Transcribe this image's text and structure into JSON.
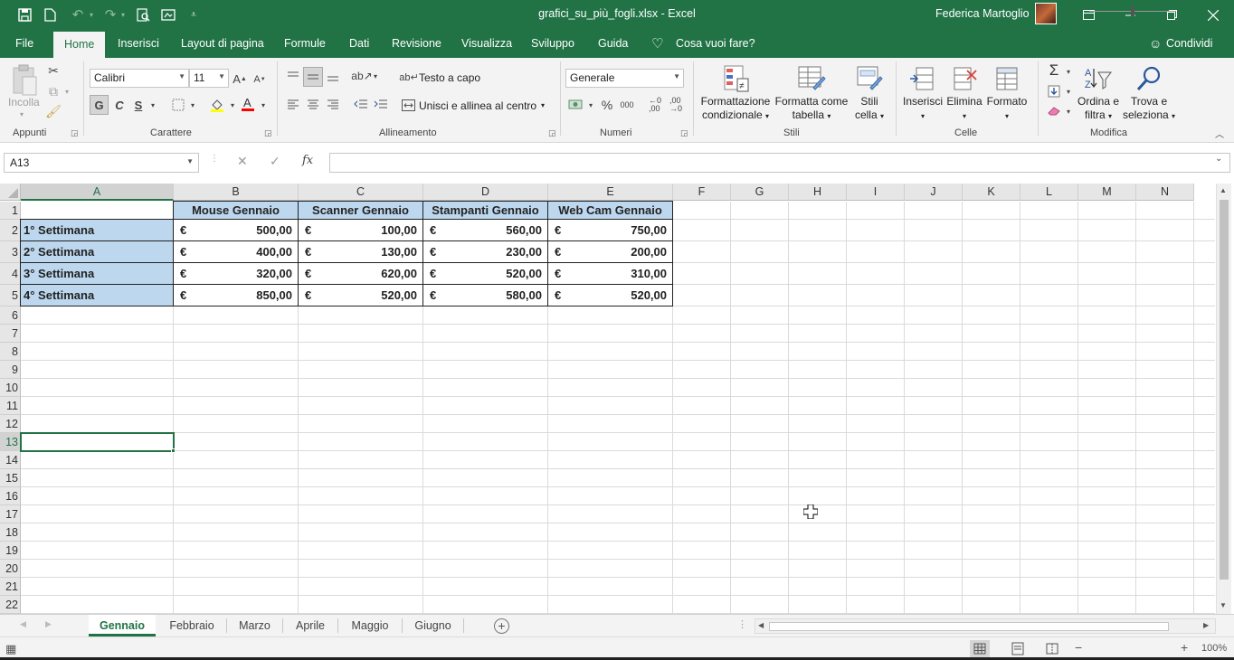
{
  "titlebar": {
    "filename": "grafici_su_più_fogli.xlsx  -  Excel",
    "user": "Federica Martoglio",
    "icons": [
      "save-icon",
      "new-file-icon",
      "undo-icon",
      "redo-icon",
      "print-preview-icon",
      "camera-icon",
      "customize-icon"
    ]
  },
  "menu": {
    "tabs": [
      "File",
      "Home",
      "Inserisci",
      "Layout di pagina",
      "Formule",
      "Dati",
      "Revisione",
      "Visualizza",
      "Sviluppo",
      "Guida"
    ],
    "active": "Home",
    "tell_me": "Cosa vuoi fare?",
    "share": "Condividi"
  },
  "ribbon": {
    "clipboard": {
      "paste": "Incolla",
      "label": "Appunti"
    },
    "font": {
      "name": "Calibri",
      "size": "11",
      "bold": "G",
      "italic": "C",
      "underline": "S",
      "label": "Carattere"
    },
    "alignment": {
      "wrap": "Testo a capo",
      "merge": "Unisci e allinea al centro",
      "label": "Allineamento"
    },
    "number": {
      "format": "Generale",
      "percent": "%",
      "thousands": "000",
      "label": "Numeri"
    },
    "styles": {
      "cond_format": "Formattazione",
      "cond_format2": "condizionale",
      "format_table": "Formatta come",
      "format_table2": "tabella",
      "cell_styles": "Stili",
      "cell_styles2": "cella",
      "label": "Stili"
    },
    "cells": {
      "insert": "Inserisci",
      "delete": "Elimina",
      "format": "Formato",
      "label": "Celle"
    },
    "editing": {
      "sort": "Ordina e",
      "sort2": "filtra",
      "find": "Trova e",
      "find2": "seleziona",
      "label": "Modifica"
    }
  },
  "formula_bar": {
    "name_box": "A13",
    "fx": "fx",
    "content": ""
  },
  "columns": [
    "A",
    "B",
    "C",
    "D",
    "E",
    "F",
    "G",
    "H",
    "I",
    "J",
    "K",
    "L",
    "M",
    "N"
  ],
  "rows": [
    "1",
    "2",
    "3",
    "4",
    "5",
    "6",
    "7",
    "8",
    "9",
    "10",
    "11",
    "12",
    "13",
    "14",
    "15",
    "16",
    "17",
    "18",
    "19",
    "20",
    "21",
    "22"
  ],
  "table": {
    "headers": [
      "Mouse Gennaio",
      "Scanner Gennaio",
      "Stampanti Gennaio",
      "Web Cam Gennaio"
    ],
    "currency": "€",
    "rows": [
      {
        "label": "1° Settimana",
        "values": [
          "500,00",
          "100,00",
          "560,00",
          "750,00"
        ]
      },
      {
        "label": "2° Settimana",
        "values": [
          "400,00",
          "130,00",
          "230,00",
          "200,00"
        ]
      },
      {
        "label": "3° Settimana",
        "values": [
          "320,00",
          "620,00",
          "520,00",
          "310,00"
        ]
      },
      {
        "label": "4° Settimana",
        "values": [
          "850,00",
          "520,00",
          "580,00",
          "520,00"
        ]
      }
    ]
  },
  "selected_cell": "A13",
  "sheets": [
    "Gennaio",
    "Febbraio",
    "Marzo",
    "Aprile",
    "Maggio",
    "Giugno"
  ],
  "active_sheet": "Gennaio",
  "status": {
    "zoom": "100%"
  },
  "colors": {
    "accent": "#217346",
    "header_fill": "#bdd7ee"
  }
}
